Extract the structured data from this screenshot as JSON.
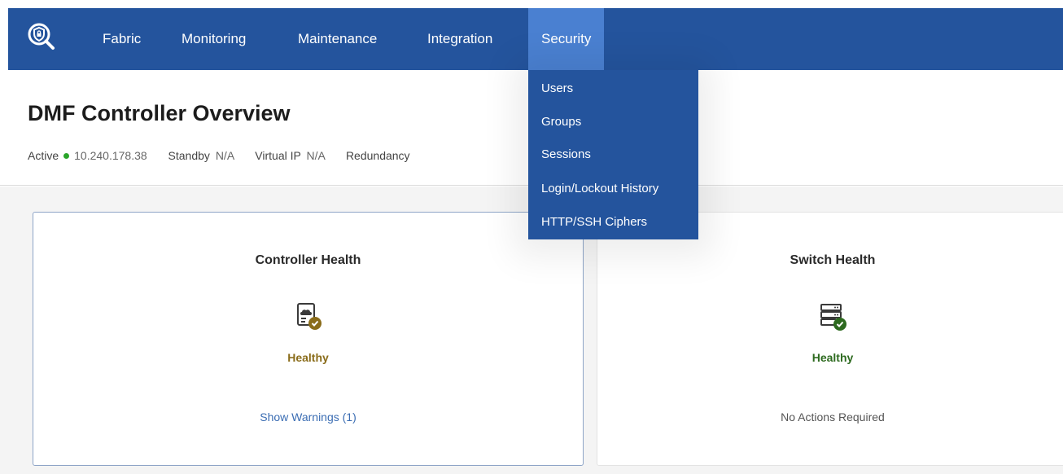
{
  "nav": {
    "items": [
      {
        "label": "Fabric"
      },
      {
        "label": "Monitoring"
      },
      {
        "label": "Maintenance"
      },
      {
        "label": "Integration"
      },
      {
        "label": "Security"
      }
    ],
    "active": "Security",
    "color": "#24549d",
    "active_color": "#4a80d1"
  },
  "security_menu": {
    "items": [
      {
        "label": "Users"
      },
      {
        "label": "Groups"
      },
      {
        "label": "Sessions"
      },
      {
        "label": "Login/Lockout History"
      },
      {
        "label": "HTTP/SSH Ciphers"
      }
    ]
  },
  "header": {
    "title": "DMF Controller Overview",
    "active_label": "Active",
    "active_value": "10.240.178.38",
    "active_status_color": "#2aa52a",
    "standby_label": "Standby",
    "standby_value": "N/A",
    "virtual_ip_label": "Virtual IP",
    "virtual_ip_value": "N/A",
    "redundancy_label": "Redundancy"
  },
  "cards": {
    "controller": {
      "title": "Controller Health",
      "state": "Healthy",
      "state_color": "#8a6c1a",
      "action": "Show Warnings (1)",
      "icon": "clipboard-check-icon"
    },
    "switch": {
      "title": "Switch Health",
      "state": "Healthy",
      "state_color": "#2d6a1f",
      "action": "No Actions Required",
      "icon": "server-check-icon"
    }
  }
}
